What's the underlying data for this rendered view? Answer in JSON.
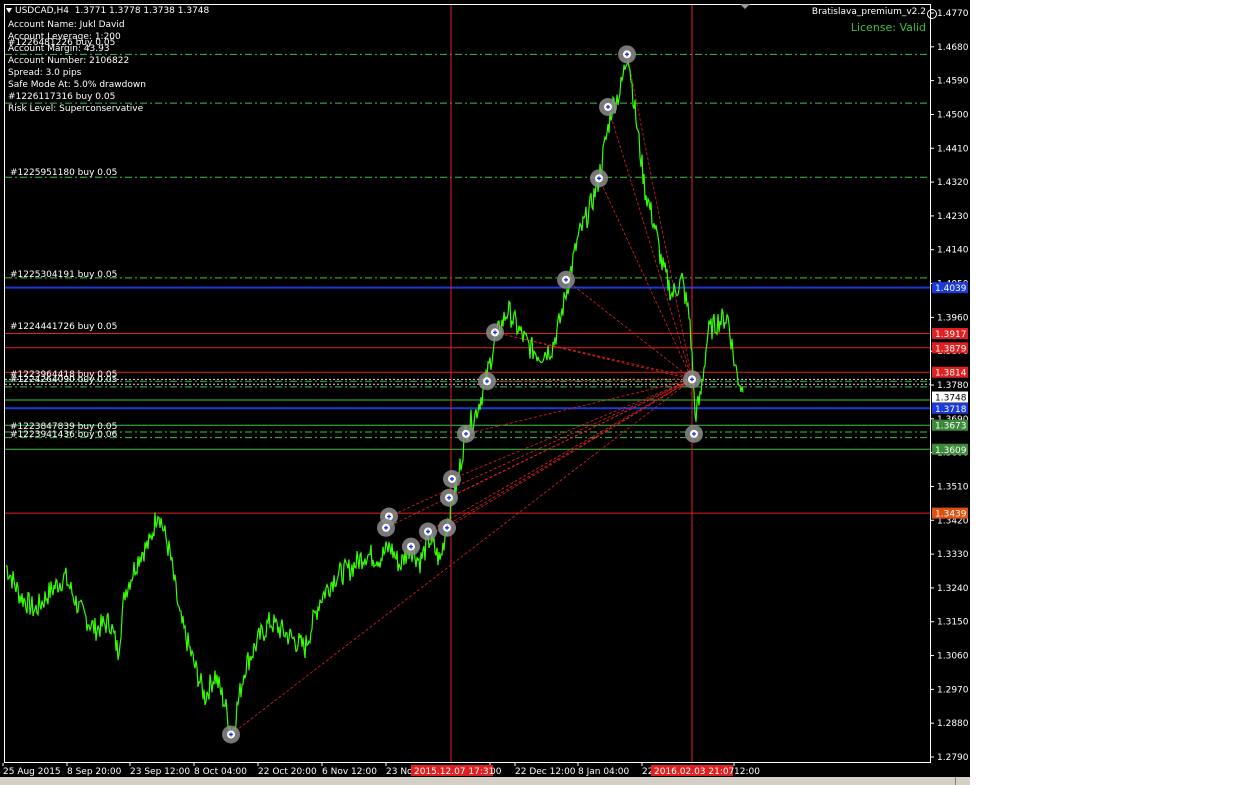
{
  "header": {
    "symbol": "USDCAD,H4",
    "ohlc": "1.3771 1.3778 1.3738 1.3748"
  },
  "ea": {
    "name": "Bratislava_premium_v2.2",
    "license": "License: Valid"
  },
  "info_lines": [
    "Account Name: Jukl David",
    "Account Leverage: 1:200",
    "Account Margin: 43.93",
    "Account Number: 2106822",
    "Spread: 3.0 pips",
    "Safe Mode At: 5.0% drawdown",
    "Risk Level: Superconservative"
  ],
  "order_labels": [
    {
      "text": "#1226481226 buy 0.05"
    },
    {
      "text": "#1226117316 buy 0.05"
    },
    {
      "text": "#1225951180 buy 0.05"
    },
    {
      "text": "#1225304191 buy 0.05"
    },
    {
      "text": "#1224441726 buy 0.05"
    },
    {
      "text": "#1223964418 buy 0.05"
    },
    {
      "text": "#1224264090 buy 0.05"
    },
    {
      "text": "#1223847839 buy 0.05"
    },
    {
      "text": "#1223941436 buy 0.06"
    }
  ],
  "price_axis": [
    "1.4770",
    "1.4680",
    "1.4590",
    "1.4500",
    "1.4410",
    "1.4320",
    "1.4230",
    "1.4140",
    "1.4050",
    "1.3960",
    "1.3870",
    "1.3780",
    "1.3690",
    "1.3600",
    "1.3510",
    "1.3420",
    "1.3330",
    "1.3240",
    "1.3150",
    "1.3060",
    "1.2970",
    "1.2880",
    "1.2790"
  ],
  "price_tags": [
    {
      "value": "1.4039",
      "bg": "#1b3bd8",
      "fg": "#ffffff"
    },
    {
      "value": "1.3917",
      "bg": "#e02020",
      "fg": "#ffffff"
    },
    {
      "value": "1.3879",
      "bg": "#e02020",
      "fg": "#ffffff"
    },
    {
      "value": "1.3814",
      "bg": "#e02020",
      "fg": "#ffffff"
    },
    {
      "value": "1.3748",
      "bg": "#ffffff",
      "fg": "#000000"
    },
    {
      "value": "1.3718",
      "bg": "#1b3bd8",
      "fg": "#ffffff"
    },
    {
      "value": "1.3673",
      "bg": "#3a8a3a",
      "fg": "#ffffff"
    },
    {
      "value": "1.3609",
      "bg": "#3a8a3a",
      "fg": "#ffffff"
    },
    {
      "value": "1.3439",
      "bg": "#e05010",
      "fg": "#ffffff"
    }
  ],
  "time_axis": [
    {
      "label": "25 Aug 2015"
    },
    {
      "label": "8 Sep 20:00"
    },
    {
      "label": "23 Sep 12:00"
    },
    {
      "label": "8 Oct 04:00"
    },
    {
      "label": "22 Oct 20:00"
    },
    {
      "label": "6 Nov 12:00"
    },
    {
      "label": "23 No"
    },
    {
      "label": "00"
    },
    {
      "label": "22 Dec 12:00"
    },
    {
      "label": "8 Jan 04:00"
    },
    {
      "label": "22"
    },
    {
      "label": "12:00"
    }
  ],
  "time_highlights": [
    {
      "label": "2015.12.07 17:31"
    },
    {
      "label": "2016.02.03 21:07"
    }
  ],
  "colors": {
    "price_line": "#33ff00",
    "background": "#000000",
    "order_line": "#e02020",
    "buy_line": "#3fbf3f",
    "blue_line": "#1b3bd8"
  }
}
